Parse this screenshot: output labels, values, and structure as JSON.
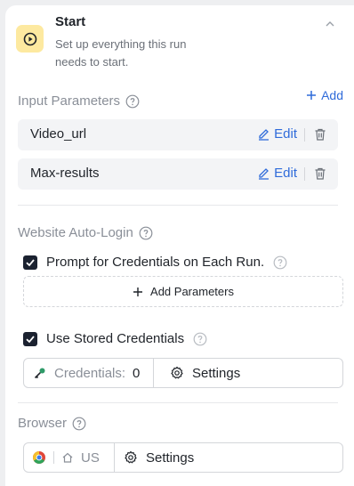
{
  "start": {
    "title": "Start",
    "description": "Set up everything this run needs to start."
  },
  "input_parameters": {
    "label": "Input Parameters",
    "add_label": "Add",
    "items": [
      {
        "name": "Video_url",
        "edit_label": "Edit"
      },
      {
        "name": "Max-results",
        "edit_label": "Edit"
      }
    ]
  },
  "auto_login": {
    "label": "Website Auto-Login",
    "prompt_credentials_label": "Prompt for Credentials on Each Run.",
    "prompt_credentials_checked": true,
    "add_parameters_label": "Add Parameters",
    "stored_credentials_label": "Use Stored Credentials",
    "stored_credentials_checked": true,
    "credentials_label": "Credentials:",
    "credentials_count": "0",
    "settings_label": "Settings"
  },
  "browser": {
    "label": "Browser",
    "region": "US",
    "settings_label": "Settings"
  },
  "icons": {
    "play": "play-circle-icon",
    "collapse": "chevron-up-icon",
    "help": "question-circle-icon",
    "add": "plus-icon",
    "edit": "pencil-icon",
    "delete": "trash-icon",
    "key": "key-icon",
    "settings": "gear-icon",
    "chrome": "chrome-icon",
    "home": "home-icon"
  },
  "colors": {
    "accent": "#2f6bda",
    "badge_bg": "#fde9a0",
    "checkbox": "#1b2230"
  }
}
